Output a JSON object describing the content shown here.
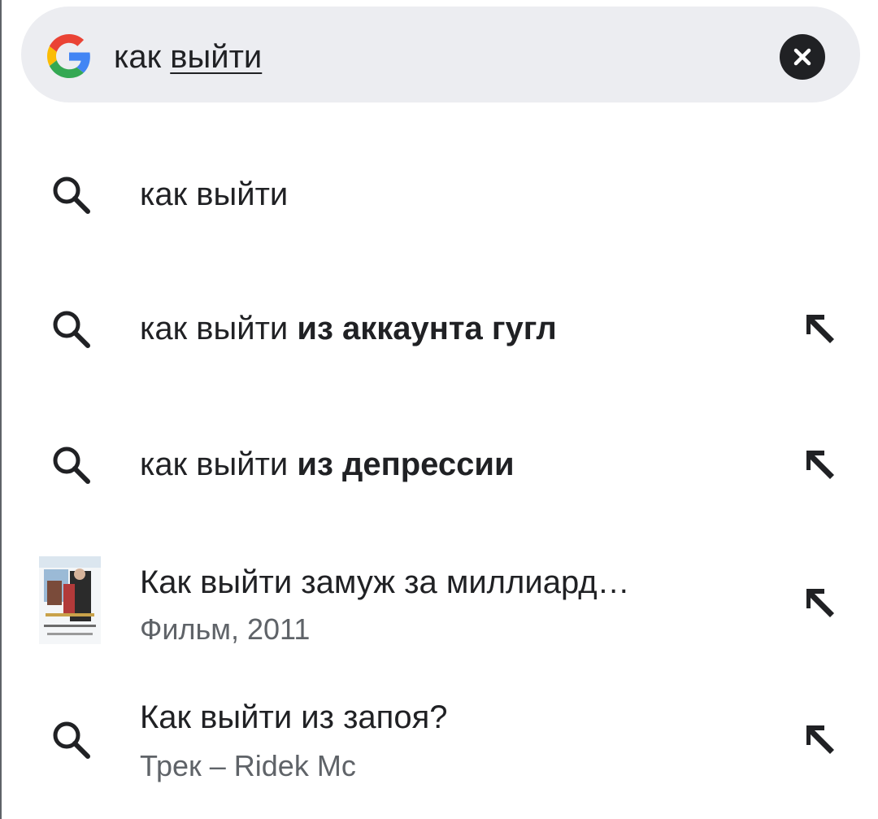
{
  "search": {
    "typed": "как ",
    "composing": "выйти",
    "logo": "google-g-icon",
    "clear_icon": "close-icon"
  },
  "suggestions": [
    {
      "prefix": "как выйти",
      "bold": "",
      "icon": "search-icon",
      "fill_icon": false
    },
    {
      "prefix": "как выйти ",
      "bold": "из аккаунта гугл",
      "icon": "search-icon",
      "fill_icon": true
    },
    {
      "prefix": "как выйти ",
      "bold": "из депрессии",
      "icon": "search-icon",
      "fill_icon": true
    },
    {
      "title": "Как выйти замуж за миллиард…",
      "subtitle": "Фильм, 2011",
      "icon": "movie-poster-thumbnail",
      "fill_icon": true
    },
    {
      "title": "Как выйти из запоя?",
      "subtitle": "Трек – Ridek Mc",
      "icon": "search-icon",
      "fill_icon": true
    }
  ],
  "colors": {
    "search_bar_bg": "#ecedf1",
    "text": "#202124",
    "subtext": "#5f6368",
    "google_blue": "#4285F4",
    "google_red": "#EA4335",
    "google_yellow": "#FBBC05",
    "google_green": "#34A853"
  }
}
